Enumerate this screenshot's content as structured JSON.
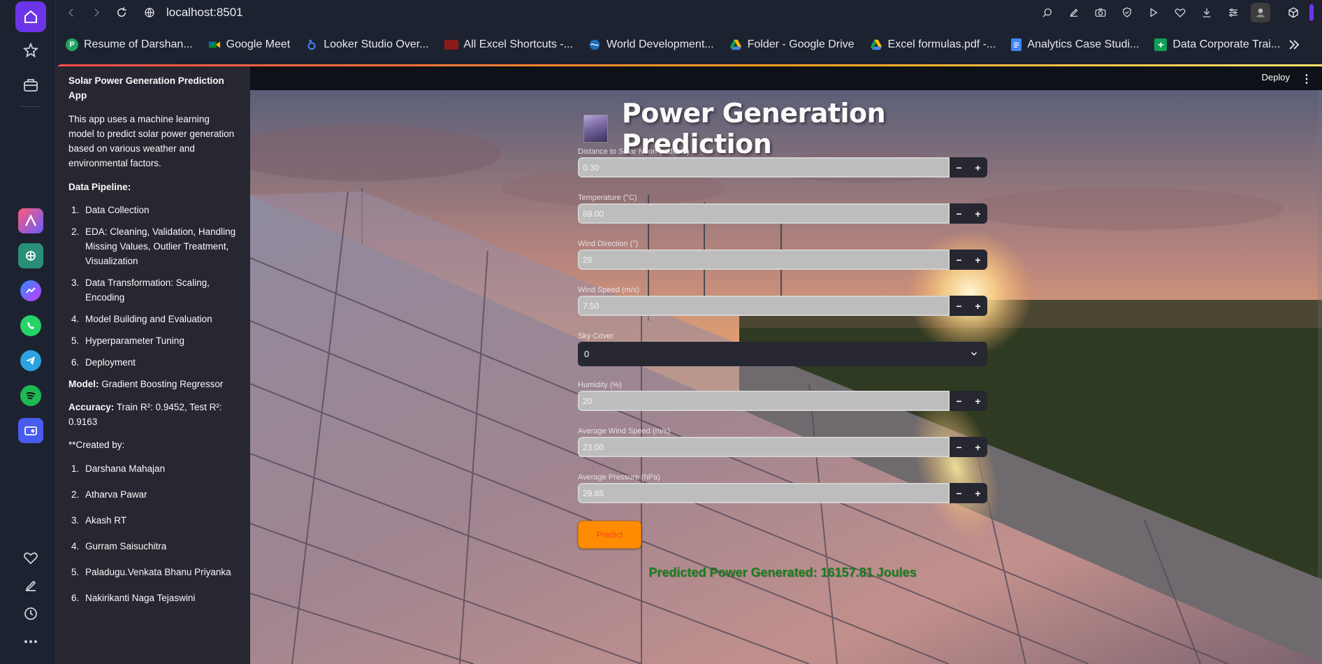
{
  "browser": {
    "url": "localhost:8501",
    "bookmarks": [
      {
        "label": "Resume of Darshan...",
        "icon": "resume-icon",
        "color": "#1fa463",
        "glyph": "P"
      },
      {
        "label": "Google Meet",
        "icon": "google-meet-icon",
        "color": "#00832d",
        "glyph": ""
      },
      {
        "label": "Looker Studio Over...",
        "icon": "looker-studio-icon",
        "color": "#4285f4",
        "glyph": ""
      },
      {
        "label": "All Excel Shortcuts -...",
        "icon": "excel-shortcuts-icon",
        "color": "#8b1a1a",
        "glyph": ""
      },
      {
        "label": "World Development...",
        "icon": "world-development-icon",
        "color": "#1e6fb8",
        "glyph": ""
      },
      {
        "label": "Folder - Google Drive",
        "icon": "google-drive-icon",
        "color": "#fbbc04",
        "glyph": ""
      },
      {
        "label": "Excel formulas.pdf -...",
        "icon": "google-drive-icon",
        "color": "#fbbc04",
        "glyph": ""
      },
      {
        "label": "Analytics Case Studi...",
        "icon": "google-docs-icon",
        "color": "#4285f4",
        "glyph": ""
      },
      {
        "label": "Data Corporate Trai...",
        "icon": "google-sheets-icon",
        "color": "#0f9d58",
        "glyph": "+"
      }
    ]
  },
  "app": {
    "header": {
      "deploy_label": "Deploy",
      "menu_label": "⋮"
    },
    "sidebar": {
      "title": "Solar Power Generation Prediction App",
      "description": "This app uses a machine learning model to predict solar power generation based on various weather and environmental factors.",
      "pipeline_heading": "Data Pipeline:",
      "pipeline": [
        "Data Collection",
        "EDA: Cleaning, Validation, Handling Missing Values, Outlier Treatment, Visualization",
        "Data Transformation: Scaling, Encoding",
        "Model Building and Evaluation",
        "Hyperparameter Tuning",
        "Deployment"
      ],
      "model_label": "Model:",
      "model_value": "Gradient Boosting Regressor",
      "accuracy_label": "Accuracy:",
      "accuracy_value": "Train R²: 0.9452, Test R²: 0.9163",
      "created_by": "**Created by:",
      "creators": [
        "Darshana Mahajan",
        "Atharva Pawar",
        "Akash RT",
        "Gurram Saisuchitra",
        "Paladugu.Venkata Bhanu Priyanka",
        "Nakirikanti Naga Tejaswini"
      ]
    },
    "main": {
      "title": "Power Generation Prediction",
      "fields": [
        {
          "label": "Distance to Solar Noon (radians)",
          "value": "0.30",
          "type": "number"
        },
        {
          "label": "Temperature (°C)",
          "value": "69.00",
          "type": "number"
        },
        {
          "label": "Wind Direction (°)",
          "value": "28",
          "type": "number"
        },
        {
          "label": "Wind Speed (m/s)",
          "value": "7.50",
          "type": "number"
        },
        {
          "label": "Sky Cover",
          "value": "0",
          "type": "select"
        },
        {
          "label": "Humidity (%)",
          "value": "20",
          "type": "number"
        },
        {
          "label": "Average Wind Speed (m/s)",
          "value": "23.00",
          "type": "number"
        },
        {
          "label": "Average Pressure (hPa)",
          "value": "29.85",
          "type": "number"
        }
      ],
      "predict_label": "Predict",
      "result": "Predicted Power Generated: 16157.81 Joules"
    }
  },
  "colors": {
    "accent": "#6d35e8",
    "predict_button": "#ff8c00",
    "result_text": "#17801f"
  }
}
